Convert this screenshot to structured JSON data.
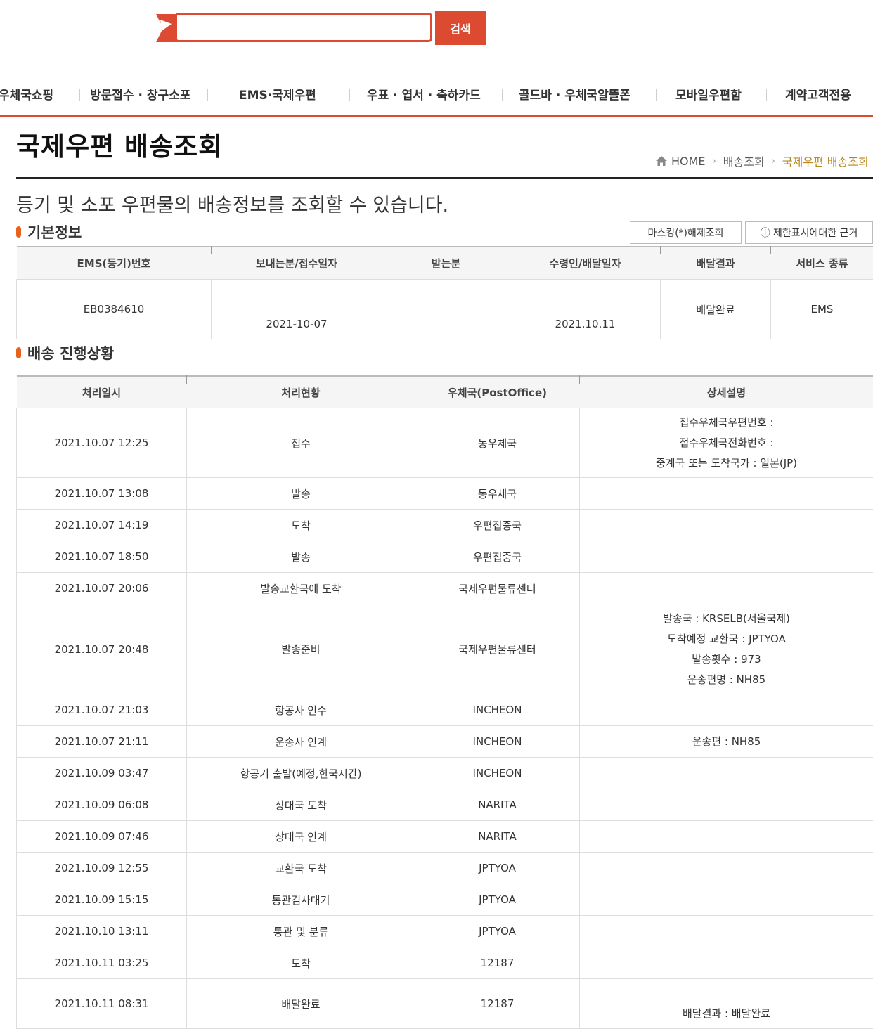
{
  "search": {
    "placeholder": "",
    "button_label": "검색",
    "accent_color": "#dc4a32"
  },
  "nav": {
    "items": [
      "우체국쇼핑",
      "방문접수 · 창구소포",
      "EMS·국제우편",
      "우표 · 엽서 · 축하카드",
      "골드바 · 우체국알뜰폰",
      "모바일우편함",
      "계약고객전용"
    ]
  },
  "page": {
    "title": "국제우편 배송조회",
    "description": "등기 및 소포 우편물의 배송정보를 조회할 수 있습니다."
  },
  "breadcrumb": {
    "home": "HOME",
    "level1": "배송조회",
    "current": "국제우편 배송조회"
  },
  "basic": {
    "section_title": "기본정보",
    "masking_button": "마스킹(*)해제조회",
    "restriction_button": "ⓘ 제한표시에대한 근거",
    "headers": [
      "EMS(등기)번호",
      "보내는분/접수일자",
      "받는분",
      "수령인/배달일자",
      "배달결과",
      "서비스 종류"
    ],
    "row": {
      "ems_number": "EB0384610",
      "sent_date": "2021-10-07",
      "receiver": "",
      "delivered_date": "2021.10.11",
      "result": "배달완료",
      "service": "EMS"
    }
  },
  "tracking": {
    "section_title": "배송 진행상황",
    "headers": [
      "처리일시",
      "처리현황",
      "우체국(PostOffice)",
      "상세설명"
    ],
    "rows": [
      {
        "datetime": "2021.10.07 12:25",
        "status": "접수",
        "office": "동우체국",
        "details": [
          "접수우체국우편번호 :",
          "접수우체국전화번호 :",
          "중계국 또는 도착국가 : 일본(JP)"
        ]
      },
      {
        "datetime": "2021.10.07 13:08",
        "status": "발송",
        "office": "동우체국",
        "details": []
      },
      {
        "datetime": "2021.10.07 14:19",
        "status": "도착",
        "office": "우편집중국",
        "details": []
      },
      {
        "datetime": "2021.10.07 18:50",
        "status": "발송",
        "office": "우편집중국",
        "details": []
      },
      {
        "datetime": "2021.10.07 20:06",
        "status": "발송교환국에 도착",
        "office": "국제우편물류센터",
        "details": []
      },
      {
        "datetime": "2021.10.07 20:48",
        "status": "발송준비",
        "office": "국제우편물류센터",
        "details": [
          "발송국 : KRSELB(서울국제)",
          "도착예정 교환국 : JPTYOA",
          "발송횟수 : 973",
          "운송편명 : NH85"
        ]
      },
      {
        "datetime": "2021.10.07 21:03",
        "status": "항공사 인수",
        "office": "INCHEON",
        "details": []
      },
      {
        "datetime": "2021.10.07 21:11",
        "status": "운송사 인계",
        "office": "INCHEON",
        "details": [
          "운송편 : NH85"
        ]
      },
      {
        "datetime": "2021.10.09 03:47",
        "status": "항공기 출발(예정,한국시간)",
        "office": "INCHEON",
        "details": []
      },
      {
        "datetime": "2021.10.09 06:08",
        "status": "상대국 도착",
        "office": "NARITA",
        "details": []
      },
      {
        "datetime": "2021.10.09 07:46",
        "status": "상대국 인계",
        "office": "NARITA",
        "details": []
      },
      {
        "datetime": "2021.10.09 12:55",
        "status": "교환국 도착",
        "office": "JPTYOA",
        "details": []
      },
      {
        "datetime": "2021.10.09 15:15",
        "status": "통관검사대기",
        "office": "JPTYOA",
        "details": []
      },
      {
        "datetime": "2021.10.10 13:11",
        "status": "통관 및 분류",
        "office": "JPTYOA",
        "details": []
      },
      {
        "datetime": "2021.10.11 03:25",
        "status": "도착",
        "office": "12187",
        "details": []
      },
      {
        "datetime": "2021.10.11 08:31",
        "status": "배달완료",
        "office": "12187",
        "details": [
          "배달결과 : 배달완료"
        ]
      }
    ]
  }
}
